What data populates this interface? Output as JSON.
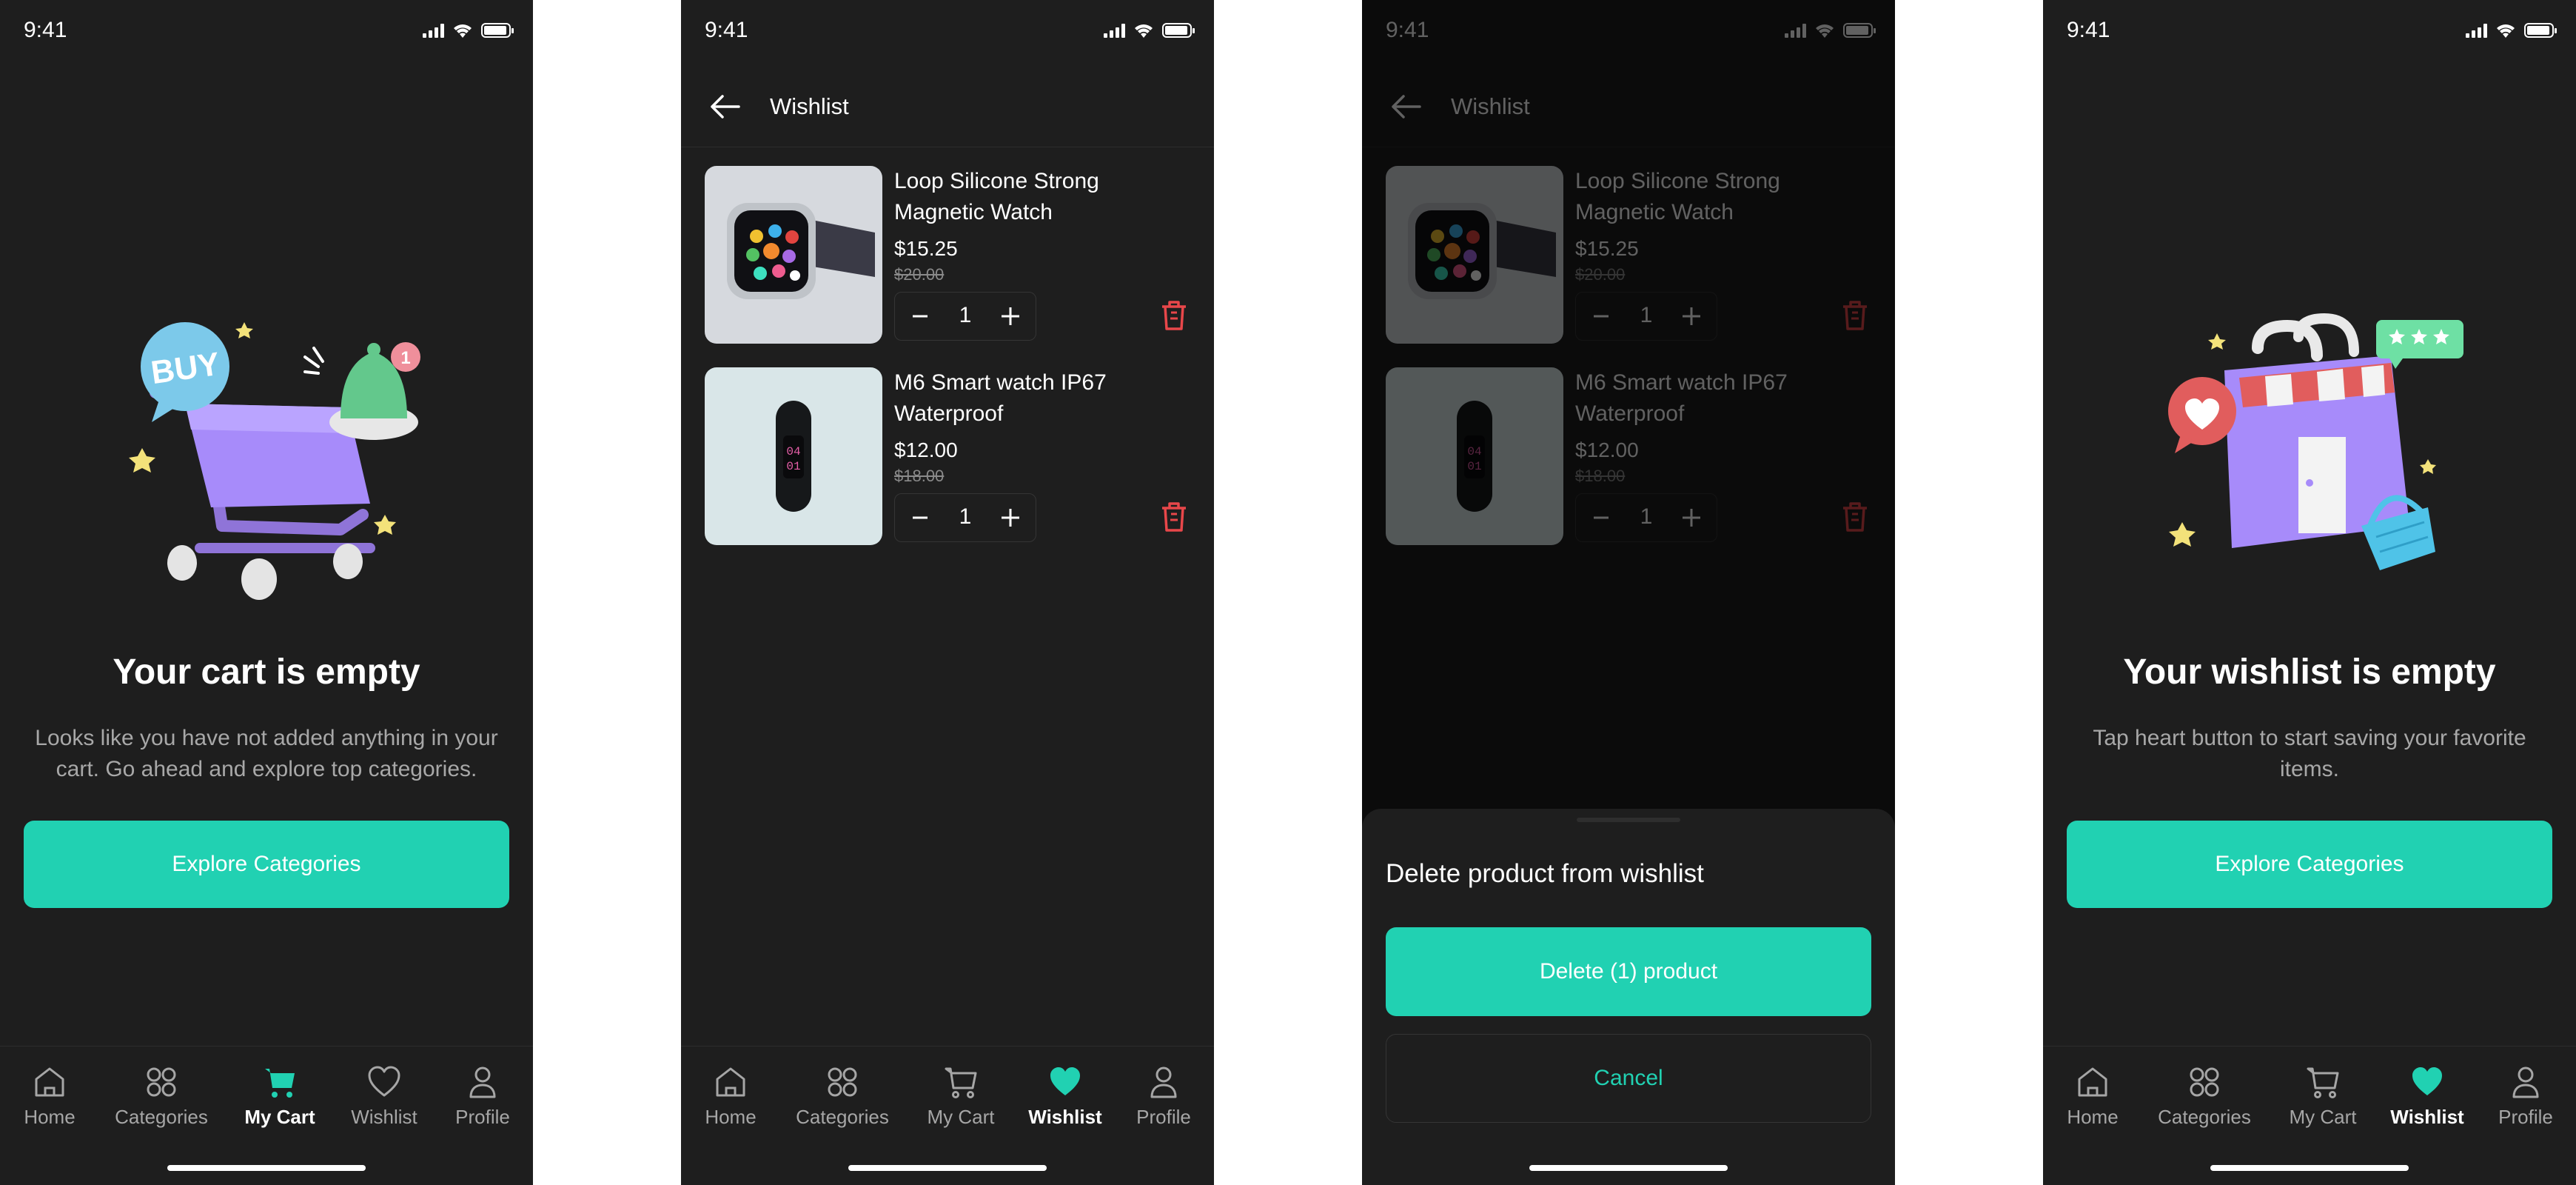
{
  "status_time": "9:41",
  "nav": {
    "home": "Home",
    "categories": "Categories",
    "my_cart": "My Cart",
    "wishlist": "Wishlist",
    "profile": "Profile"
  },
  "cart_empty": {
    "title": "Your cart is empty",
    "description": "Looks like you have not added anything in your cart. Go ahead and explore top categories.",
    "button": "Explore Categories",
    "illustration_badge": "BUY",
    "notification_count": "1"
  },
  "wishlist": {
    "title": "Wishlist",
    "items": [
      {
        "name": "Loop Silicone Strong Magnetic Watch",
        "price": "$15.25",
        "old_price": "$20.00",
        "quantity": "1"
      },
      {
        "name": "M6 Smart watch IP67 Waterproof",
        "price": "$12.00",
        "old_price": "$18.00",
        "quantity": "1"
      }
    ]
  },
  "delete_sheet": {
    "title": "Delete product from wishlist",
    "delete_button": "Delete (1) product",
    "cancel_button": "Cancel"
  },
  "wishlist_empty": {
    "title": "Your wishlist is empty",
    "description": "Tap heart button to start saving your favorite items.",
    "button": "Explore Categories"
  },
  "colors": {
    "accent": "#21d1b2",
    "background": "#1e1e1e",
    "danger": "#e8474a",
    "muted_text": "#a6a6a6"
  }
}
